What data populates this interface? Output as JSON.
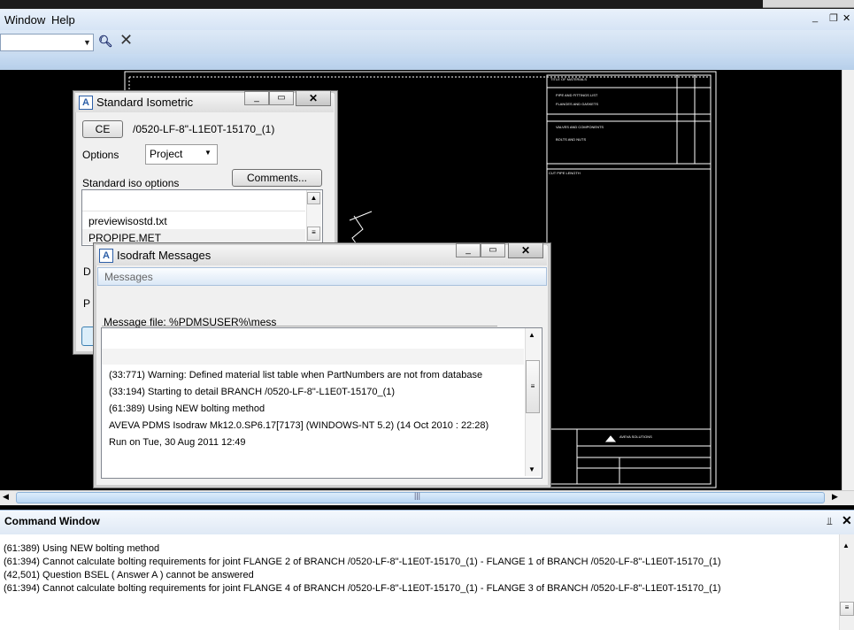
{
  "menubar": {
    "items": [
      "Window",
      "Help"
    ],
    "mdi_minimize": "_",
    "mdi_restore": "❐",
    "mdi_close": "✕"
  },
  "toolbar": {
    "search_value": "",
    "find_icon": "binoculars-icon",
    "clear_icon": "close-icon"
  },
  "iso_dialog": {
    "title": "Standard Isometric",
    "ce_button": "CE",
    "ce_value": "/0520-LF-8\"-L1E0T-15170_(1)",
    "options_label": "Options",
    "options_value": "Project",
    "std_options_label": "Standard iso options",
    "comments_button": "Comments...",
    "list_items": [
      "previewisostd.txt",
      "PROPIPE.MET"
    ],
    "partial_label_d": "D",
    "partial_label_p": "P"
  },
  "msg_dialog": {
    "title": "Isodraft Messages",
    "section_label": "Messages",
    "message_file": "Message file: %PDMSUSER%\\mess",
    "lines": [
      "(33:771) Warning: Defined material list table when PartNumbers are not from database",
      "(33:194) Starting to detail BRANCH /0520-LF-8\"-L1E0T-15170_(1)",
      "(61:389) Using NEW bolting method",
      "AVEVA PDMS Isodraw Mk12.0.SP6.17[7173]  (WINDOWS-NT 5.2)  (14 Oct 2010 : 22:28)",
      "Run on Tue, 30 Aug 2011 12:49"
    ]
  },
  "command_window": {
    "title": "Command Window",
    "pin_icon": "⫫",
    "close_icon": "✕",
    "lines": [
      "(61:389) Using NEW bolting method",
      "(61:394) Cannot calculate bolting requirements for joint FLANGE 2 of BRANCH /0520-LF-8\"-L1E0T-15170_(1) - FLANGE 1 of BRANCH /0520-LF-8\"-L1E0T-15170_(1)",
      "(42,501)  Question BSEL ( Answer A ) cannot be answered",
      "(61:394) Cannot calculate bolting requirements for joint FLANGE 4 of BRANCH /0520-LF-8\"-L1E0T-15170_(1) - FLANGE 3 of BRANCH /0520-LF-8\"-L1E0T-15170_(1)"
    ]
  },
  "colors": {
    "canvas": "#000000",
    "drawing_lines": "#ffffff",
    "chrome": "#d6e4f5"
  }
}
